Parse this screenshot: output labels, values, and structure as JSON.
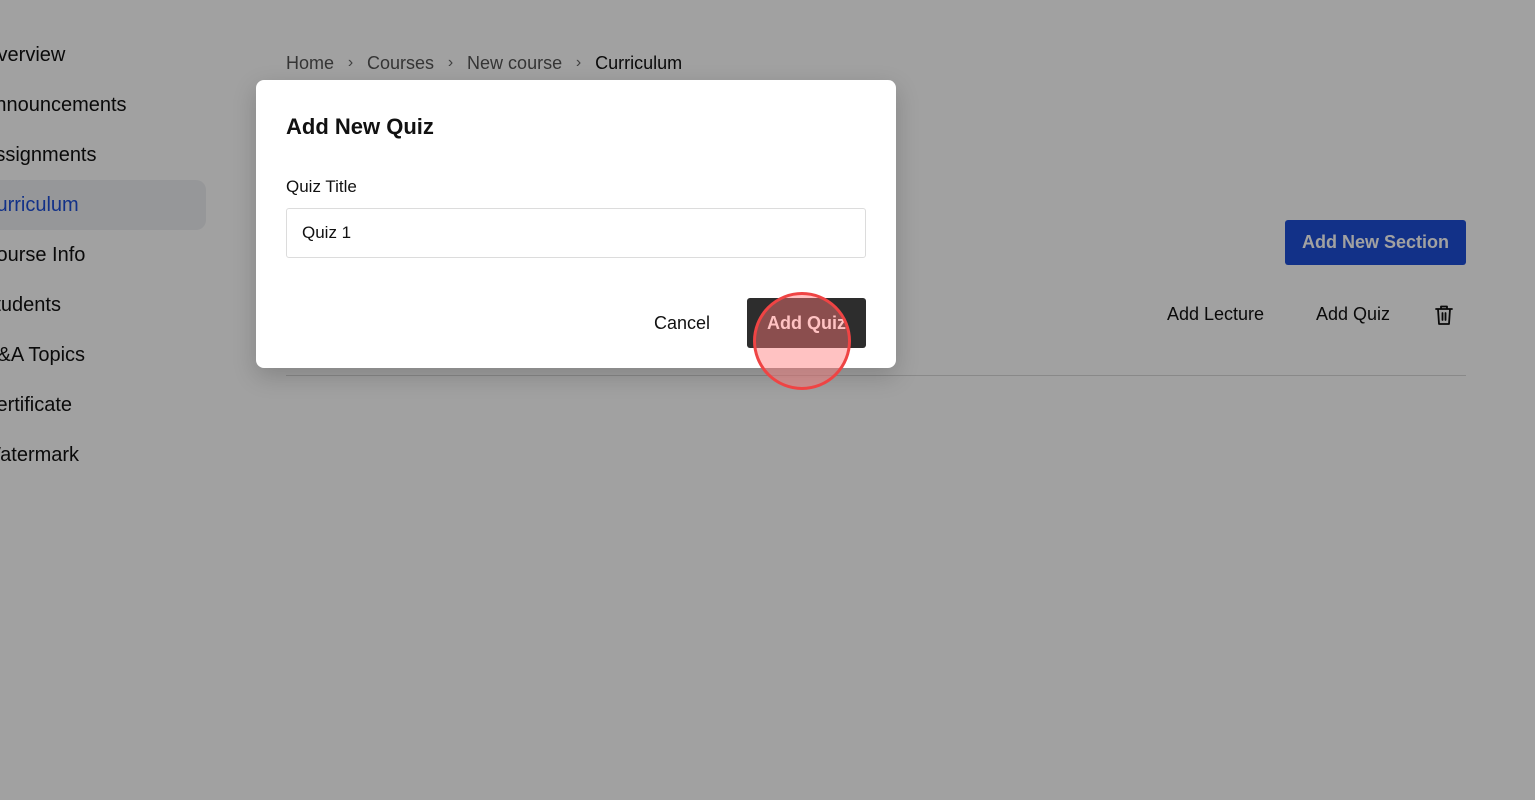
{
  "sidebar": {
    "items": [
      {
        "label": "Overview"
      },
      {
        "label": "Announcements"
      },
      {
        "label": "Assignments"
      },
      {
        "label": "Curriculum"
      },
      {
        "label": "Course Info"
      },
      {
        "label": "Students"
      },
      {
        "label": "Q&A Topics"
      },
      {
        "label": "Certificate"
      },
      {
        "label": "Watermark"
      }
    ],
    "active_index": 3
  },
  "breadcrumb": {
    "items": [
      "Home",
      "Courses",
      "New course",
      "Curriculum"
    ],
    "separator": "›"
  },
  "main": {
    "add_section_label": "Add New Section",
    "section_actions": {
      "add_lecture_label": "Add Lecture",
      "add_quiz_label": "Add Quiz",
      "delete_icon": "trash-icon"
    }
  },
  "modal": {
    "title": "Add New Quiz",
    "field_label": "Quiz Title",
    "quiz_title_value": "Quiz 1",
    "cancel_label": "Cancel",
    "submit_label": "Add Quiz"
  },
  "colors": {
    "accent": "#1d4ed8",
    "dark_button": "#2d2d2d",
    "active_sidebar_bg": "#eef0f3",
    "overlay": "rgba(0,0,0,0.37)",
    "click_indicator": "#ef4444"
  }
}
